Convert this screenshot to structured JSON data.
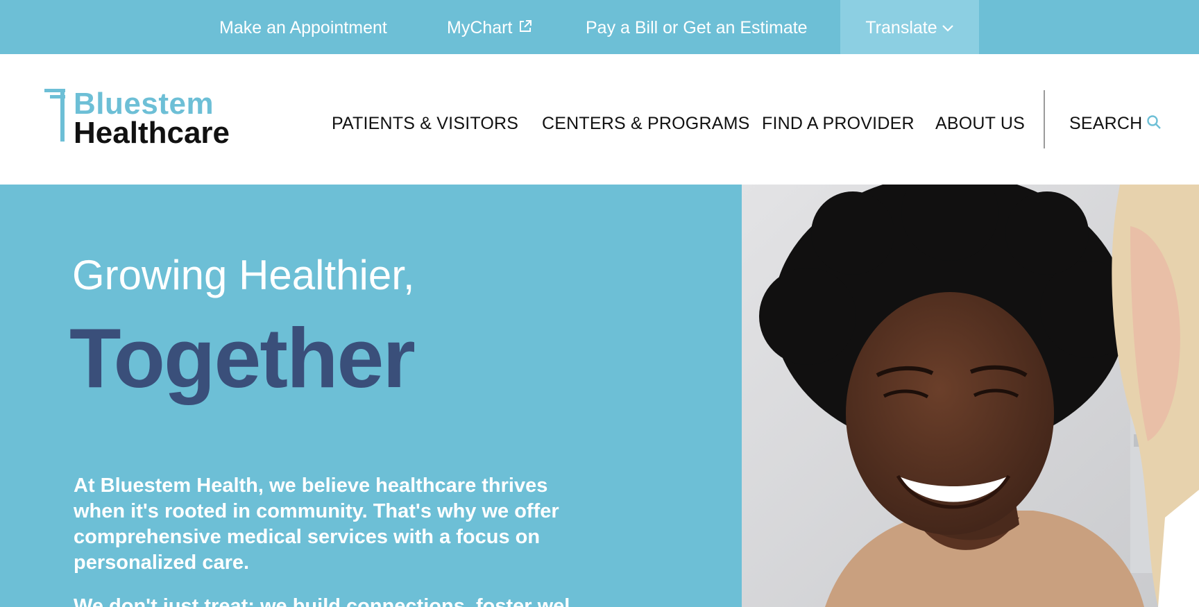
{
  "utility_bar": {
    "appointment_label": "Make an Appointment",
    "mychart_label": "MyChart",
    "pay_label": "Pay a Bill or Get an Estimate",
    "translate_label": "Translate"
  },
  "brand": {
    "line1": "Bluestem",
    "line2": "Healthcare"
  },
  "nav": {
    "items": [
      {
        "label": "PATIENTS & VISITORS"
      },
      {
        "label": "CENTERS & PROGRAMS"
      },
      {
        "label": "FIND A PROVIDER"
      },
      {
        "label": "ABOUT US"
      }
    ],
    "search_label": "SEARCH"
  },
  "hero": {
    "subtitle": "Growing Healthier,",
    "title": "Together",
    "body": "At Bluestem Health, we believe healthcare thrives when it's rooted in community. That's why we offer comprehensive medical services with a focus on personalized care.",
    "body_cutoff": "We don't just treat; we build connections, foster wel"
  },
  "colors": {
    "accent": "#6dbfd6",
    "accent_light": "#8ccfe2",
    "navy": "#3a4f7a",
    "text_dark": "#111111"
  }
}
